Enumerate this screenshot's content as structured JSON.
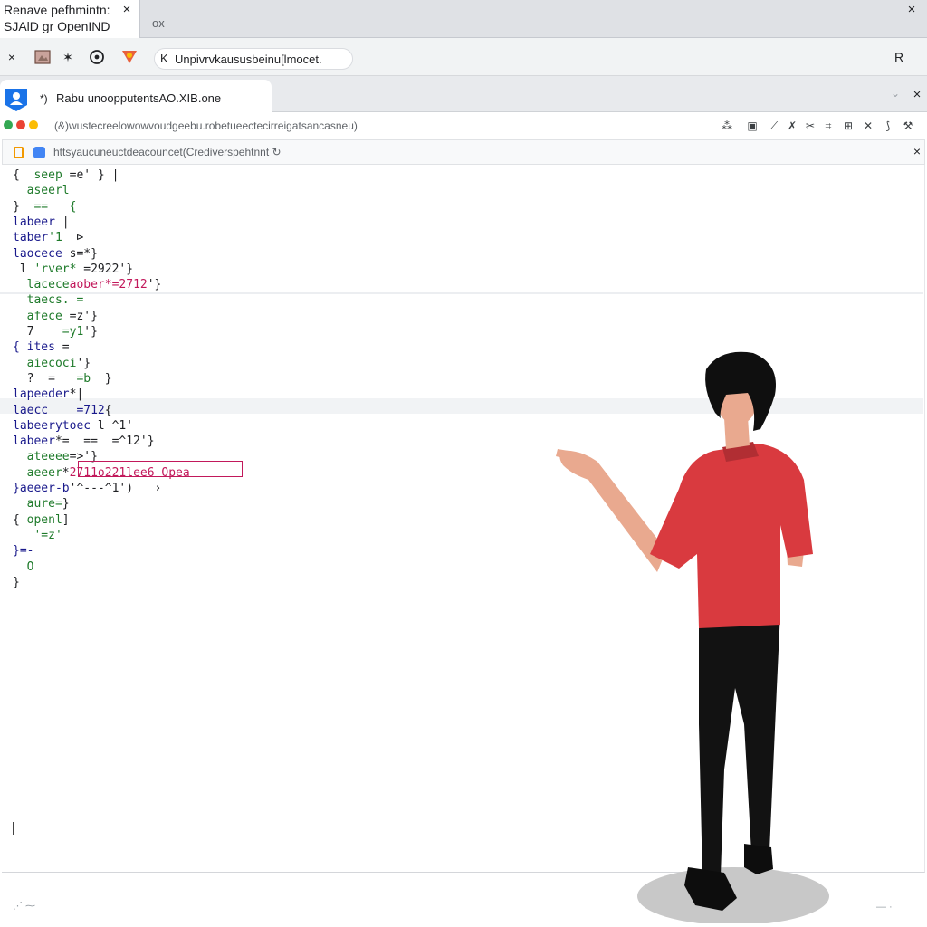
{
  "window": {
    "tab_title_line1": "Renave pefhmintn:",
    "tab_title_line2": "SJAlD gr OpenIND",
    "tab_close": "×",
    "tab2_glyph": "ox",
    "close": "×"
  },
  "navbar": {
    "close": "×",
    "star": "✶",
    "omnibox_prefix": "K",
    "omnibox_text": "Unpivrvkaususbeinu[lmocet.",
    "right_icon": "R"
  },
  "titlerow2": {
    "glyph": "*)",
    "tab_title": "Rabu unoopputentsAO.XIB.one",
    "mini": "⌄",
    "close": "×"
  },
  "extbar": {
    "url": "(&)wustecreelowowvoudgeebu.robetueectecirreigatsancasneu)"
  },
  "innerbar": {
    "url": "httsyaucuneuctdeacouncet(Crediverspehtnnt",
    "reload": "↻",
    "close": "×"
  },
  "code": {
    "lines": [
      {
        "parts": [
          {
            "t": "{  ",
            "c": "c-dark"
          },
          {
            "t": "seep ",
            "c": "c-green"
          },
          {
            "t": "=e' } |",
            "c": "c-dark"
          }
        ]
      },
      {
        "parts": [
          {
            "t": "  aseerl",
            "c": "c-green"
          }
        ]
      },
      {
        "parts": [
          {
            "t": "}  ",
            "c": "c-dark"
          },
          {
            "t": "==   {",
            "c": "c-green"
          }
        ]
      },
      {
        "parts": [
          {
            "t": "labeer",
            "c": "c-blue"
          },
          {
            "t": " |",
            "c": "c-dark"
          }
        ]
      },
      {
        "parts": [
          {
            "t": "taber",
            "c": "c-blue"
          },
          {
            "t": "'1  ",
            "c": "c-green"
          },
          {
            "t": "⊳",
            "c": "c-dark"
          }
        ]
      },
      {
        "parts": [
          {
            "t": "laocece ",
            "c": "c-blue"
          },
          {
            "t": "s=*}",
            "c": "c-dark"
          }
        ]
      },
      {
        "parts": [
          {
            "t": " l ",
            "c": "c-dark"
          },
          {
            "t": "'rver* ",
            "c": "c-green"
          },
          {
            "t": "=2922'",
            "c": "c-dark"
          },
          {
            "t": "}",
            "c": "c-dark"
          }
        ]
      },
      {
        "parts": [
          {
            "t": "  lacece",
            "c": "c-green"
          },
          {
            "t": "aober",
            "c": "c-red"
          },
          {
            "t": "*=2712",
            "c": "c-red"
          },
          {
            "t": "'}",
            "c": "c-dark"
          }
        ]
      },
      {
        "parts": [
          {
            "t": "  taecs. =",
            "c": "c-green"
          }
        ]
      },
      {
        "parts": [
          {
            "t": "  afece ",
            "c": "c-green"
          },
          {
            "t": "=z'}",
            "c": "c-dark"
          }
        ]
      },
      {
        "parts": [
          {
            "t": "  7    ",
            "c": "c-dark"
          },
          {
            "t": "=y1",
            "c": "c-green"
          },
          {
            "t": "'}",
            "c": "c-dark"
          }
        ]
      },
      {
        "parts": [
          {
            "t": "{ ites ",
            "c": "c-blue"
          },
          {
            "t": "=",
            "c": "c-dark"
          }
        ]
      },
      {
        "parts": [
          {
            "t": "  aiecoci",
            "c": "c-green"
          },
          {
            "t": "'}",
            "c": "c-dark"
          }
        ]
      },
      {
        "parts": [
          {
            "t": "  ?  =   ",
            "c": "c-dark"
          },
          {
            "t": "=b",
            "c": "c-green"
          },
          {
            "t": "  }",
            "c": "c-dark"
          }
        ]
      },
      {
        "parts": [
          {
            "t": "lapeeder",
            "c": "c-blue"
          },
          {
            "t": "*|",
            "c": "c-dark"
          }
        ]
      },
      {
        "parts": [
          {
            "t": "laecc    ",
            "c": "c-blue"
          },
          {
            "t": "=712",
            "c": "c-blue"
          },
          {
            "t": "{",
            "c": "c-dark"
          }
        ]
      },
      {
        "parts": [
          {
            "t": "labeerytoec ",
            "c": "c-blue"
          },
          {
            "t": "l ^1'",
            "c": "c-dark"
          }
        ]
      },
      {
        "parts": [
          {
            "t": "labeer",
            "c": "c-blue"
          },
          {
            "t": "*=  ==  =^12'",
            "c": "c-dark"
          },
          {
            "t": "}",
            "c": "c-dark"
          }
        ]
      },
      {
        "parts": [
          {
            "t": "  ateeee",
            "c": "c-green"
          },
          {
            "t": "=>'}",
            "c": "c-dark"
          }
        ]
      },
      {
        "parts": [
          {
            "t": "  aeeer",
            "c": "c-green"
          },
          {
            "t": "*",
            "c": "c-dark"
          },
          {
            "t": "2711o221lee6 Opea",
            "c": "c-red"
          }
        ]
      },
      {
        "parts": [
          {
            "t": "}aeeer-b",
            "c": "c-blue"
          },
          {
            "t": "'^---^1')   ",
            "c": "c-dark"
          },
          {
            "t": "›",
            "c": "c-dark"
          }
        ]
      },
      {
        "parts": [
          {
            "t": "  aure=",
            "c": "c-green"
          },
          {
            "t": "}",
            "c": "c-dark"
          }
        ]
      },
      {
        "parts": [
          {
            "t": "{ ",
            "c": "c-dark"
          },
          {
            "t": "openl",
            "c": "c-green"
          },
          {
            "t": "]",
            "c": "c-dark"
          }
        ]
      },
      {
        "parts": [
          {
            "t": "   ",
            "c": "c-dark"
          },
          {
            "t": "'=z'",
            "c": "c-green"
          }
        ]
      },
      {
        "parts": [
          {
            "t": "}=-",
            "c": "c-blue"
          }
        ]
      },
      {
        "parts": [
          {
            "t": "  ",
            "c": "c-dark"
          },
          {
            "t": "O",
            "c": "c-green"
          }
        ]
      },
      {
        "parts": [
          {
            "t": "}",
            "c": "c-dark"
          }
        ]
      }
    ]
  },
  "colors": {
    "accent_blue": "#1a73e8",
    "shirt_red": "#d93a3f",
    "code_keyword": "#1a1a8c",
    "code_string": "#1e7a2a",
    "code_highlight": "#c2185b"
  },
  "icons": {
    "nav": [
      "close-icon",
      "image-icon",
      "star-icon",
      "refresh-icon",
      "extension-icon"
    ],
    "tools": [
      "grid-icon",
      "box-icon",
      "wrench-icon",
      "pin-icon",
      "scissors-icon",
      "puzzle-icon",
      "tools-icon",
      "cross-tools-icon"
    ]
  }
}
